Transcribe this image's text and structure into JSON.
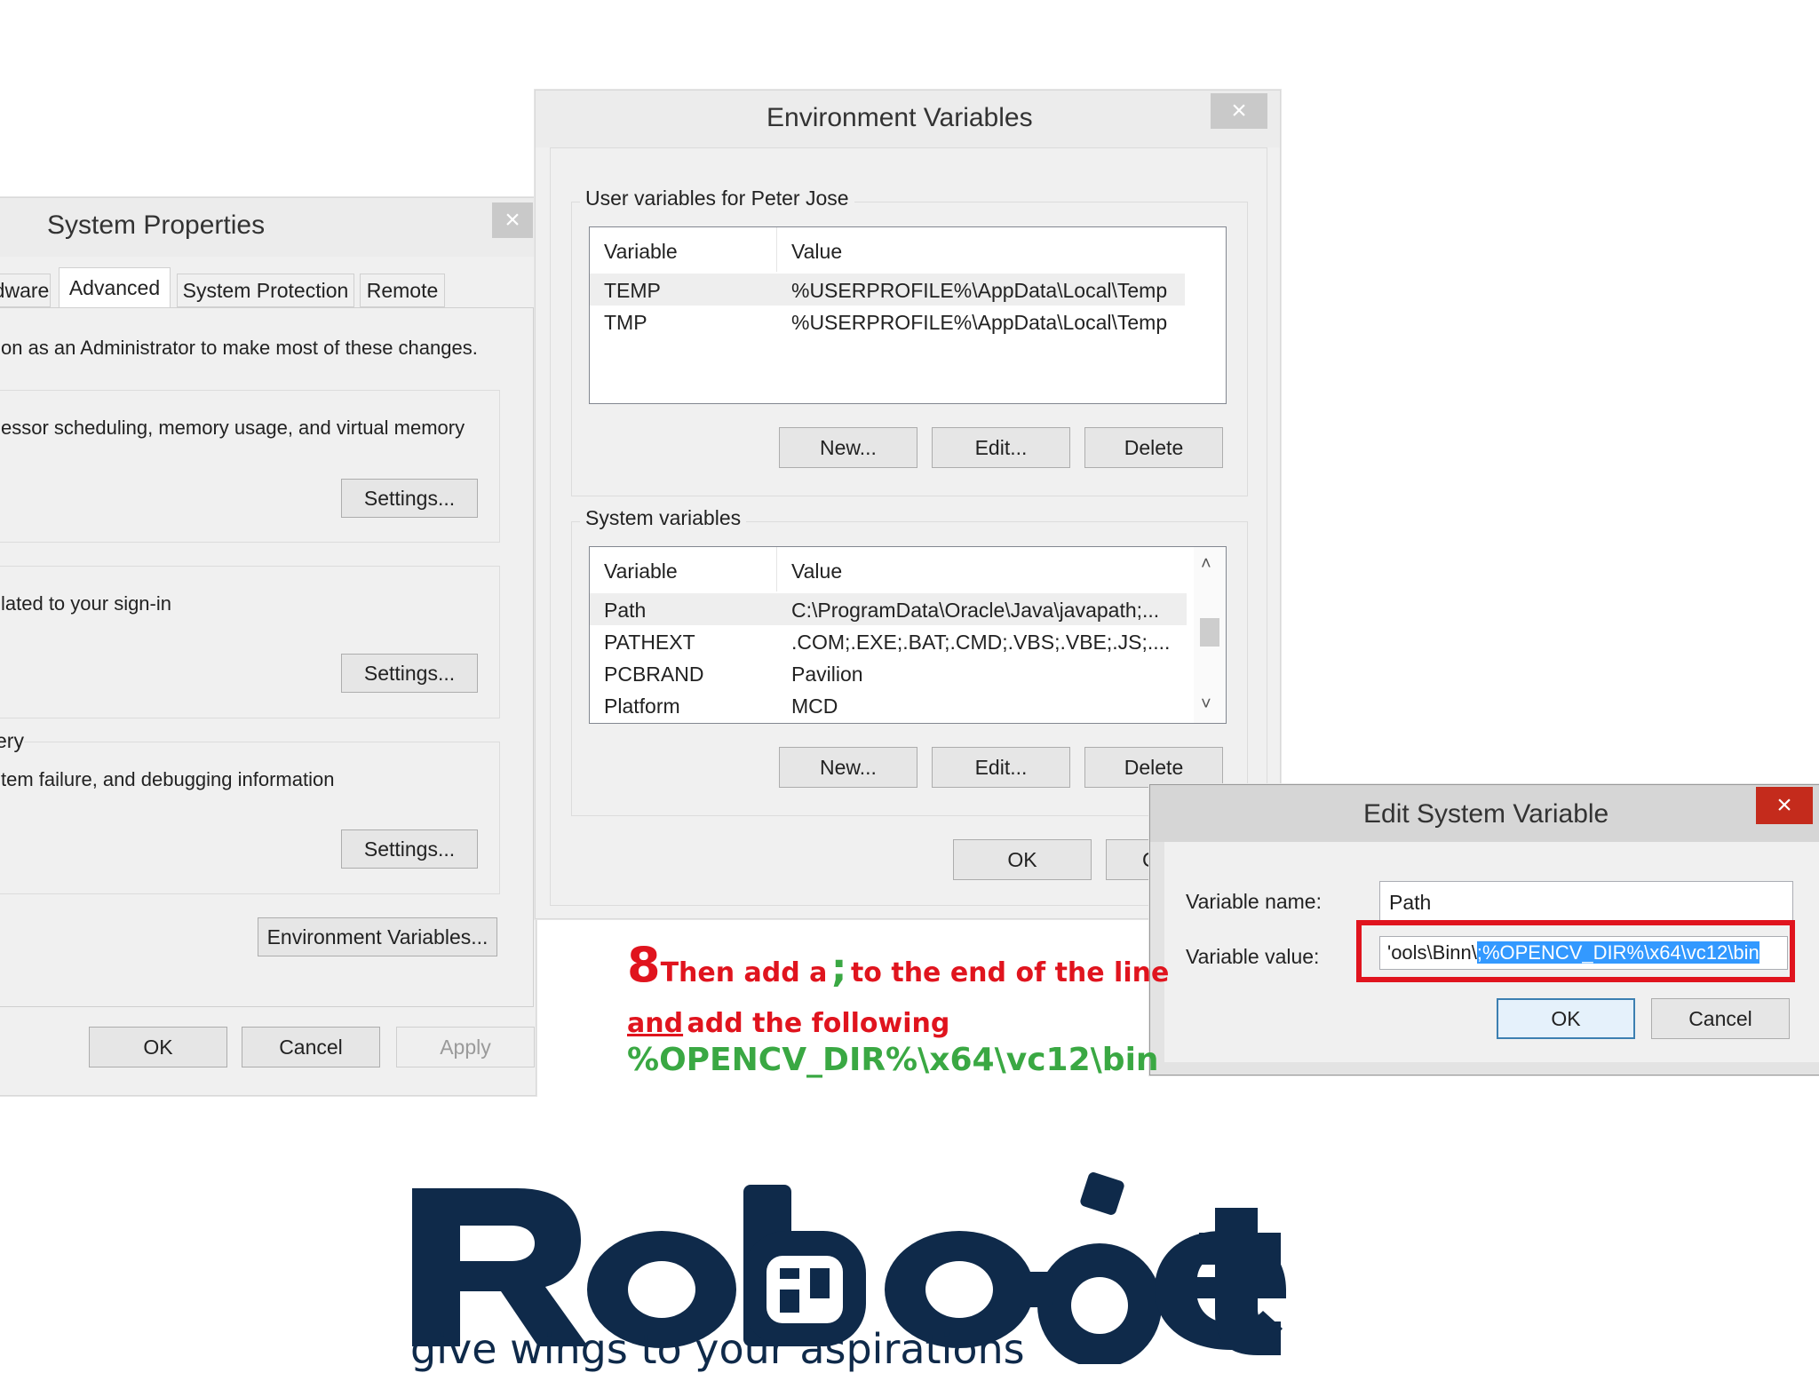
{
  "system_properties": {
    "title": "System Properties",
    "tabs": [
      "dware",
      "Advanced",
      "System Protection",
      "Remote"
    ],
    "admin_note": "on as an Administrator to make most of these changes.",
    "performance_desc": "essor scheduling, memory usage, and virtual memory",
    "profiles_desc": "lated to your sign-in",
    "startup_label": "ery",
    "startup_desc": "tem failure, and debugging information",
    "settings_label": "Settings...",
    "env_vars_label": "Environment Variables...",
    "ok": "OK",
    "cancel": "Cancel",
    "apply": "Apply"
  },
  "env_vars": {
    "title": "Environment Variables",
    "user_group": "User variables for Peter Jose",
    "system_group": "System variables",
    "col_variable": "Variable",
    "col_value": "Value",
    "user_rows": [
      {
        "variable": "TEMP",
        "value": "%USERPROFILE%\\AppData\\Local\\Temp"
      },
      {
        "variable": "TMP",
        "value": "%USERPROFILE%\\AppData\\Local\\Temp"
      }
    ],
    "system_rows": [
      {
        "variable": "Path",
        "value": "C:\\ProgramData\\Oracle\\Java\\javapath;..."
      },
      {
        "variable": "PATHEXT",
        "value": ".COM;.EXE;.BAT;.CMD;.VBS;.VBE;.JS;...."
      },
      {
        "variable": "PCBRAND",
        "value": "Pavilion"
      },
      {
        "variable": "Platform",
        "value": "MCD"
      }
    ],
    "new": "New...",
    "edit": "Edit...",
    "delete": "Delete",
    "ok": "OK",
    "cancel_partial": "C"
  },
  "edit_var": {
    "title": "Edit System Variable",
    "name_label": "Variable name:",
    "name_value": "Path",
    "value_label": "Variable value:",
    "value_prefix": "'ools\\Binn\\",
    "value_selected": ";%OPENCV_DIR%\\x64\\vc12\\bin",
    "ok": "OK",
    "cancel": "Cancel",
    "highlight_color": "#e0141e"
  },
  "annotation": {
    "step": "8",
    "line1a": "Then add a",
    "semicolon": ";",
    "line1b": "to the end of the line",
    "line2a": "and",
    "line2b": "add the following",
    "line3": "%OPENCV_DIR%\\x64\\vc12\\bin",
    "colors": {
      "red": "#e0141e",
      "green": "#3aa843"
    }
  },
  "logo": {
    "brand": "Roboet",
    "tagline": "give wings to your aspirations",
    "color": "#0f2a4a"
  }
}
